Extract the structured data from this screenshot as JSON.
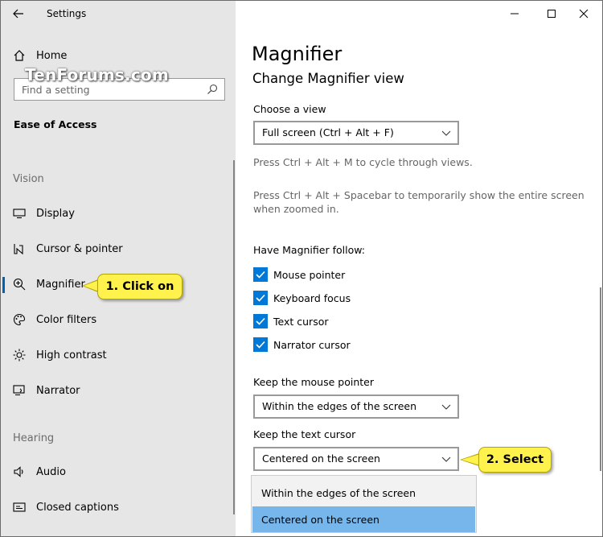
{
  "window": {
    "title": "Settings",
    "controls": [
      "minimize",
      "maximize",
      "close"
    ]
  },
  "watermark": "TenForums.com",
  "sidebar": {
    "home_label": "Home",
    "search": {
      "placeholder": "Find a setting",
      "value": ""
    },
    "section_title": "Ease of Access",
    "groups": [
      {
        "header": "Vision",
        "items": [
          {
            "label": "Display",
            "icon": "display-icon"
          },
          {
            "label": "Cursor & pointer",
            "icon": "cursor-icon"
          },
          {
            "label": "Magnifier",
            "icon": "magnifier-icon",
            "selected": true
          },
          {
            "label": "Color filters",
            "icon": "palette-icon"
          },
          {
            "label": "High contrast",
            "icon": "high-contrast-icon"
          },
          {
            "label": "Narrator",
            "icon": "narrator-icon"
          }
        ]
      },
      {
        "header": "Hearing",
        "items": [
          {
            "label": "Audio",
            "icon": "speaker-icon"
          },
          {
            "label": "Closed captions",
            "icon": "captions-icon"
          }
        ]
      }
    ]
  },
  "main": {
    "title": "Magnifier",
    "subtitle": "Change Magnifier view",
    "choose_view": {
      "label": "Choose a view",
      "value": "Full screen (Ctrl + Alt + F)"
    },
    "hint_cycle": "Press Ctrl + Alt + M to cycle through views.",
    "hint_spacebar": "Press Ctrl + Alt + Spacebar to temporarily show the entire screen when zoomed in.",
    "follow": {
      "label": "Have Magnifier follow:",
      "options": [
        {
          "label": "Mouse pointer",
          "checked": true
        },
        {
          "label": "Keyboard focus",
          "checked": true
        },
        {
          "label": "Text cursor",
          "checked": true
        },
        {
          "label": "Narrator cursor",
          "checked": true
        }
      ]
    },
    "mouse_pointer": {
      "label": "Keep the mouse pointer",
      "value": "Within the edges of the screen"
    },
    "text_cursor": {
      "label": "Keep the text cursor",
      "value": "Centered on the screen",
      "options": [
        "Within the edges of the screen",
        "Centered on the screen"
      ],
      "highlighted": "Centered on the screen"
    }
  },
  "callouts": {
    "step1": "1. Click on",
    "step2": "2. Select",
    "color": "#fff24d"
  },
  "colors": {
    "accent": "#0078d7",
    "sidebar_bg": "#e6e6e6",
    "dropdown_highlight": "#77b6ea"
  }
}
